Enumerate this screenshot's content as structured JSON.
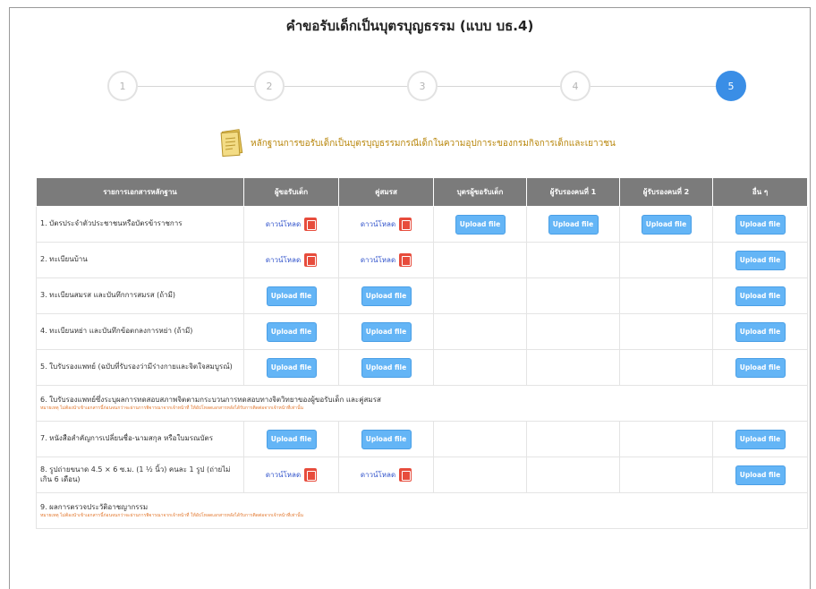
{
  "page": {
    "title": "คำขอรับเด็กเป็นบุตรบุญธรรม (แบบ บธ.4)",
    "section_heading": "หลักฐานการขอรับเด็กเป็นบุตรบุญธรรมกรณีเด็กในความอุปการะของกรมกิจการเด็กและเยาวชน"
  },
  "stepper": {
    "steps": [
      {
        "label": "1",
        "active": false
      },
      {
        "label": "2",
        "active": false
      },
      {
        "label": "3",
        "active": false
      },
      {
        "label": "4",
        "active": false
      },
      {
        "label": "5",
        "active": true
      }
    ]
  },
  "table": {
    "headers": [
      "รายการเอกสารหลักฐาน",
      "ผู้ขอรับเด็ก",
      "คู่สมรส",
      "บุตรผู้ขอรับเด็ก",
      "ผู้รับรองคนที่ 1",
      "ผู้รับรองคนที่ 2",
      "อื่น ๆ"
    ],
    "upload_label": "Upload file",
    "download_label": "ดาวน์โหลด",
    "rows": [
      {
        "label": "1. บัตรประจำตัวประชาชนหรือบัตรข้าราชการ",
        "cells": [
          "download",
          "download",
          "upload",
          "upload",
          "upload",
          "upload"
        ]
      },
      {
        "label": "2. ทะเบียนบ้าน",
        "cells": [
          "download",
          "download",
          "",
          "",
          "",
          "upload"
        ]
      },
      {
        "label": "3. ทะเบียนสมรส และบันทึกการสมรส (ถ้ามี)",
        "cells": [
          "upload",
          "upload",
          "",
          "",
          "",
          "upload"
        ]
      },
      {
        "label": "4. ทะเบียนหย่า และบันทึกข้อตกลงการหย่า (ถ้ามี)",
        "cells": [
          "upload",
          "upload",
          "",
          "",
          "",
          "upload"
        ]
      },
      {
        "label": "5. ใบรับรองแพทย์ (ฉบับที่รับรองว่ามีร่างกายและจิตใจสมบูรณ์)",
        "cells": [
          "upload",
          "upload",
          "",
          "",
          "",
          "upload"
        ]
      },
      {
        "label": "6. ใบรับรองแพทย์ซึ่งระบุผลการทดสอบสภาพจิตตามกระบวนการทดสอบทางจิตวิทยาของผู้ขอรับเด็ก และคู่สมรส",
        "note": "หมายเหตุ ไม่ต้องนำเข้าเอกสารนี้ก่อนจนกว่าจะผ่านการพิจารณาจากเจ้าหน้าที่ ให้อัปโหลดเอกสารหลังได้รับการติดต่อจากเจ้าหน้าที่เท่านั้น",
        "wide": true
      },
      {
        "label": "7. หนังสือสำคัญการเปลี่ยนชื่อ-นามสกุล หรือใบมรณบัตร",
        "cells": [
          "upload",
          "upload",
          "",
          "",
          "",
          "upload"
        ]
      },
      {
        "label": "8. รูปถ่ายขนาด 4.5 × 6 ซ.ม. (1 ½ นิ้ว) คนละ 1 รูป (ถ่ายไม่เกิน 6 เดือน)",
        "cells": [
          "download",
          "download",
          "",
          "",
          "",
          "upload"
        ]
      },
      {
        "label": "9. ผลการตรวจประวัติอาชญากรรม",
        "note": "หมายเหตุ ไม่ต้องนำเข้าเอกสารนี้ก่อนจนกว่าจะผ่านการพิจารณาจากเจ้าหน้าที่ ให้อัปโหลดเอกสารหลังได้รับการติดต่อจากเจ้าหน้าที่เท่านั้น",
        "wide": true
      }
    ]
  },
  "colors": {
    "header_bg": "#7b7b7b",
    "upload_btn": "#64b5f6",
    "active_step": "#3a8ee6",
    "heading_text": "#b8860b",
    "note_text": "#e2772d",
    "pdf_icon": "#e74c3c"
  },
  "icons": {
    "heading": "book-icon",
    "file": "pdf-icon"
  }
}
